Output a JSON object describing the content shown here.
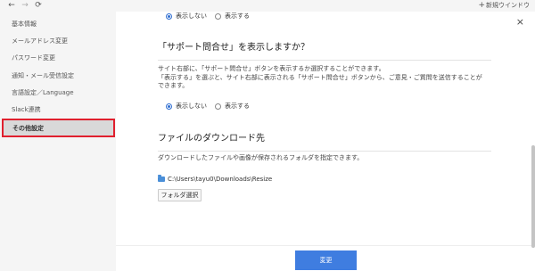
{
  "browser": {
    "back_icon": "←",
    "forward_icon": "→",
    "reload_icon": "⟳",
    "new_window_plus": "+",
    "new_window_label": "新規ウインドウ"
  },
  "sidebar": {
    "items": [
      {
        "label": "基本情報"
      },
      {
        "label": "メールアドレス変更"
      },
      {
        "label": "パスワード変更"
      },
      {
        "label": "通知・メール受信設定"
      },
      {
        "label": "言語設定／Language"
      },
      {
        "label": "Slack連携"
      },
      {
        "label": "その他設定",
        "active": true
      }
    ]
  },
  "main": {
    "close_icon": "×",
    "top_radio": {
      "options": [
        {
          "label": "表示しない",
          "checked": true
        },
        {
          "label": "表示する",
          "checked": false
        }
      ]
    },
    "support_section": {
      "title": "「サポート問合せ」を表示しますか？",
      "desc_line1": "サイト右部に、「サポート問合せ」ボタンを表示するか選択することができます。",
      "desc_line2": "「表示する」を選ぶと、サイト右部に表示される「サポート問合せ」ボタンから、ご意見・ご質問を送信することが",
      "desc_line3": "できます。",
      "options": [
        {
          "label": "表示しない",
          "checked": true
        },
        {
          "label": "表示する",
          "checked": false
        }
      ]
    },
    "download_section": {
      "title": "ファイルのダウンロード先",
      "desc": "ダウンロードしたファイルや画像が保存されるフォルダを指定できます。",
      "path": "C:\\Users\\tayu0\\Downloads\\Resize",
      "folder_button": "フォルダ選択"
    },
    "submit_label": "変更"
  }
}
